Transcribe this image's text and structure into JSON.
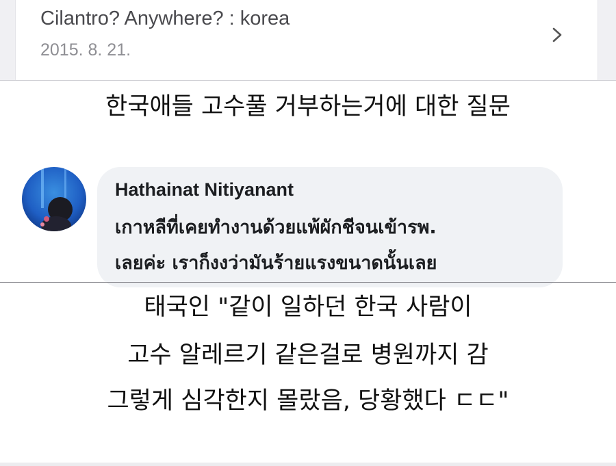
{
  "link_card": {
    "title": "Cilantro? Anywhere? : korea",
    "date": "2015. 8. 21.",
    "chevron_icon": "chevron-right-icon"
  },
  "caption_top": "한국애들 고수풀 거부하는거에 대한 질문",
  "comment": {
    "avatar_icon": "profile-avatar",
    "author": "Hathainat Nitiyanant",
    "lines": [
      "เกาหลีที่เคยทำงานด้วยแพ้ผักชีจนเข้ารพ.",
      "เลยค่ะ เราก็งงว่ามันร้ายแรงขนาดนั้นเลย"
    ]
  },
  "caption_bottom": {
    "lines": [
      "태국인 \"같이 일하던 한국 사람이",
      "고수 알레르기 같은걸로 병원까지 감",
      "그렇게 심각한지 몰랐음, 당황했다 ㄷㄷ\""
    ]
  },
  "colors": {
    "bubble_bg": "#f0f2f5",
    "card_bg": "#ffffff",
    "page_bg": "#ffffff",
    "date_gray": "#8e8e93"
  }
}
